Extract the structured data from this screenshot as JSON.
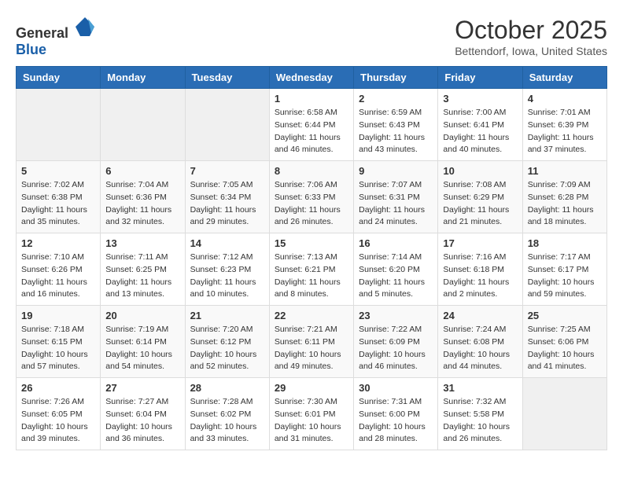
{
  "header": {
    "logo_general": "General",
    "logo_blue": "Blue",
    "month_title": "October 2025",
    "subtitle": "Bettendorf, Iowa, United States"
  },
  "weekdays": [
    "Sunday",
    "Monday",
    "Tuesday",
    "Wednesday",
    "Thursday",
    "Friday",
    "Saturday"
  ],
  "weeks": [
    [
      {
        "day": "",
        "sunrise": "",
        "sunset": "",
        "daylight": ""
      },
      {
        "day": "",
        "sunrise": "",
        "sunset": "",
        "daylight": ""
      },
      {
        "day": "",
        "sunrise": "",
        "sunset": "",
        "daylight": ""
      },
      {
        "day": "1",
        "sunrise": "Sunrise: 6:58 AM",
        "sunset": "Sunset: 6:44 PM",
        "daylight": "Daylight: 11 hours and 46 minutes."
      },
      {
        "day": "2",
        "sunrise": "Sunrise: 6:59 AM",
        "sunset": "Sunset: 6:43 PM",
        "daylight": "Daylight: 11 hours and 43 minutes."
      },
      {
        "day": "3",
        "sunrise": "Sunrise: 7:00 AM",
        "sunset": "Sunset: 6:41 PM",
        "daylight": "Daylight: 11 hours and 40 minutes."
      },
      {
        "day": "4",
        "sunrise": "Sunrise: 7:01 AM",
        "sunset": "Sunset: 6:39 PM",
        "daylight": "Daylight: 11 hours and 37 minutes."
      }
    ],
    [
      {
        "day": "5",
        "sunrise": "Sunrise: 7:02 AM",
        "sunset": "Sunset: 6:38 PM",
        "daylight": "Daylight: 11 hours and 35 minutes."
      },
      {
        "day": "6",
        "sunrise": "Sunrise: 7:04 AM",
        "sunset": "Sunset: 6:36 PM",
        "daylight": "Daylight: 11 hours and 32 minutes."
      },
      {
        "day": "7",
        "sunrise": "Sunrise: 7:05 AM",
        "sunset": "Sunset: 6:34 PM",
        "daylight": "Daylight: 11 hours and 29 minutes."
      },
      {
        "day": "8",
        "sunrise": "Sunrise: 7:06 AM",
        "sunset": "Sunset: 6:33 PM",
        "daylight": "Daylight: 11 hours and 26 minutes."
      },
      {
        "day": "9",
        "sunrise": "Sunrise: 7:07 AM",
        "sunset": "Sunset: 6:31 PM",
        "daylight": "Daylight: 11 hours and 24 minutes."
      },
      {
        "day": "10",
        "sunrise": "Sunrise: 7:08 AM",
        "sunset": "Sunset: 6:29 PM",
        "daylight": "Daylight: 11 hours and 21 minutes."
      },
      {
        "day": "11",
        "sunrise": "Sunrise: 7:09 AM",
        "sunset": "Sunset: 6:28 PM",
        "daylight": "Daylight: 11 hours and 18 minutes."
      }
    ],
    [
      {
        "day": "12",
        "sunrise": "Sunrise: 7:10 AM",
        "sunset": "Sunset: 6:26 PM",
        "daylight": "Daylight: 11 hours and 16 minutes."
      },
      {
        "day": "13",
        "sunrise": "Sunrise: 7:11 AM",
        "sunset": "Sunset: 6:25 PM",
        "daylight": "Daylight: 11 hours and 13 minutes."
      },
      {
        "day": "14",
        "sunrise": "Sunrise: 7:12 AM",
        "sunset": "Sunset: 6:23 PM",
        "daylight": "Daylight: 11 hours and 10 minutes."
      },
      {
        "day": "15",
        "sunrise": "Sunrise: 7:13 AM",
        "sunset": "Sunset: 6:21 PM",
        "daylight": "Daylight: 11 hours and 8 minutes."
      },
      {
        "day": "16",
        "sunrise": "Sunrise: 7:14 AM",
        "sunset": "Sunset: 6:20 PM",
        "daylight": "Daylight: 11 hours and 5 minutes."
      },
      {
        "day": "17",
        "sunrise": "Sunrise: 7:16 AM",
        "sunset": "Sunset: 6:18 PM",
        "daylight": "Daylight: 11 hours and 2 minutes."
      },
      {
        "day": "18",
        "sunrise": "Sunrise: 7:17 AM",
        "sunset": "Sunset: 6:17 PM",
        "daylight": "Daylight: 10 hours and 59 minutes."
      }
    ],
    [
      {
        "day": "19",
        "sunrise": "Sunrise: 7:18 AM",
        "sunset": "Sunset: 6:15 PM",
        "daylight": "Daylight: 10 hours and 57 minutes."
      },
      {
        "day": "20",
        "sunrise": "Sunrise: 7:19 AM",
        "sunset": "Sunset: 6:14 PM",
        "daylight": "Daylight: 10 hours and 54 minutes."
      },
      {
        "day": "21",
        "sunrise": "Sunrise: 7:20 AM",
        "sunset": "Sunset: 6:12 PM",
        "daylight": "Daylight: 10 hours and 52 minutes."
      },
      {
        "day": "22",
        "sunrise": "Sunrise: 7:21 AM",
        "sunset": "Sunset: 6:11 PM",
        "daylight": "Daylight: 10 hours and 49 minutes."
      },
      {
        "day": "23",
        "sunrise": "Sunrise: 7:22 AM",
        "sunset": "Sunset: 6:09 PM",
        "daylight": "Daylight: 10 hours and 46 minutes."
      },
      {
        "day": "24",
        "sunrise": "Sunrise: 7:24 AM",
        "sunset": "Sunset: 6:08 PM",
        "daylight": "Daylight: 10 hours and 44 minutes."
      },
      {
        "day": "25",
        "sunrise": "Sunrise: 7:25 AM",
        "sunset": "Sunset: 6:06 PM",
        "daylight": "Daylight: 10 hours and 41 minutes."
      }
    ],
    [
      {
        "day": "26",
        "sunrise": "Sunrise: 7:26 AM",
        "sunset": "Sunset: 6:05 PM",
        "daylight": "Daylight: 10 hours and 39 minutes."
      },
      {
        "day": "27",
        "sunrise": "Sunrise: 7:27 AM",
        "sunset": "Sunset: 6:04 PM",
        "daylight": "Daylight: 10 hours and 36 minutes."
      },
      {
        "day": "28",
        "sunrise": "Sunrise: 7:28 AM",
        "sunset": "Sunset: 6:02 PM",
        "daylight": "Daylight: 10 hours and 33 minutes."
      },
      {
        "day": "29",
        "sunrise": "Sunrise: 7:30 AM",
        "sunset": "Sunset: 6:01 PM",
        "daylight": "Daylight: 10 hours and 31 minutes."
      },
      {
        "day": "30",
        "sunrise": "Sunrise: 7:31 AM",
        "sunset": "Sunset: 6:00 PM",
        "daylight": "Daylight: 10 hours and 28 minutes."
      },
      {
        "day": "31",
        "sunrise": "Sunrise: 7:32 AM",
        "sunset": "Sunset: 5:58 PM",
        "daylight": "Daylight: 10 hours and 26 minutes."
      },
      {
        "day": "",
        "sunrise": "",
        "sunset": "",
        "daylight": ""
      }
    ]
  ]
}
